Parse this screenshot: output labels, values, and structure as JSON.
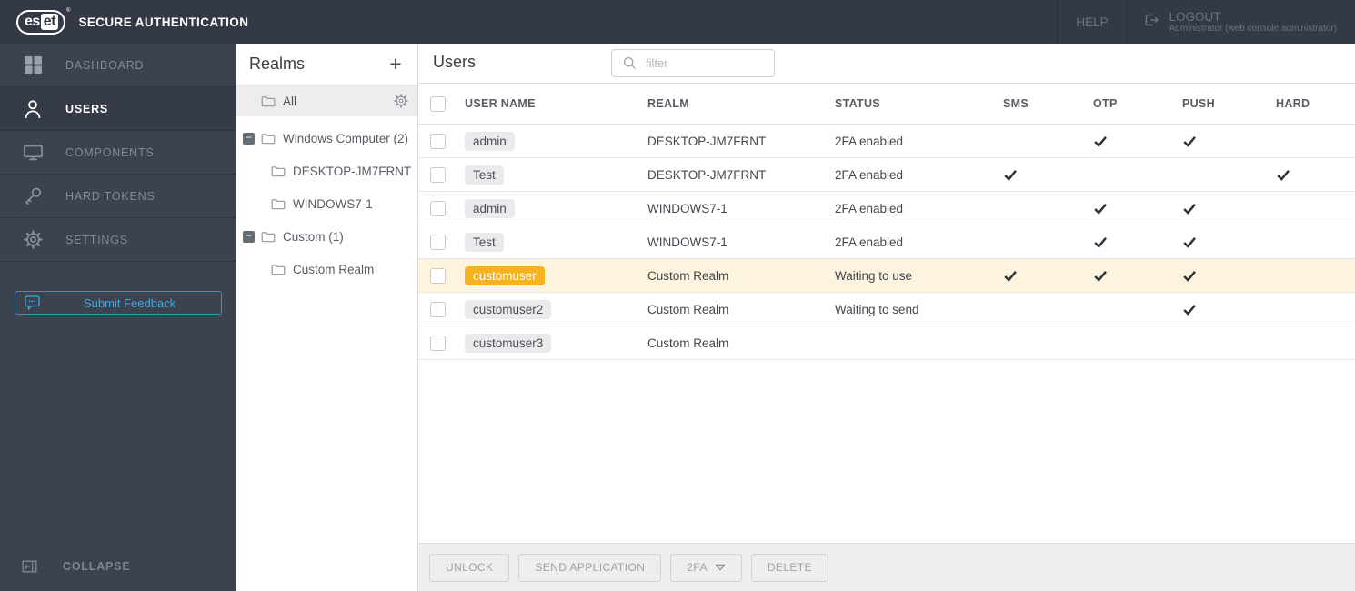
{
  "topbar": {
    "logo": {
      "left": "es",
      "right": "et",
      "reg": "®"
    },
    "product": "SECURE AUTHENTICATION",
    "help_label": "HELP",
    "logout_label": "LOGOUT",
    "logout_sub": "Administrator (web console administrator)"
  },
  "sidebar": {
    "items": [
      {
        "id": "dashboard",
        "label": "DASHBOARD",
        "icon": "grid",
        "active": false
      },
      {
        "id": "users",
        "label": "USERS",
        "icon": "user",
        "active": true
      },
      {
        "id": "components",
        "label": "COMPONENTS",
        "icon": "monitor",
        "active": false
      },
      {
        "id": "hard-tokens",
        "label": "HARD TOKENS",
        "icon": "key",
        "active": false
      },
      {
        "id": "settings",
        "label": "SETTINGS",
        "icon": "gear",
        "active": false
      }
    ],
    "feedback_label": "Submit Feedback",
    "collapse_label": "COLLAPSE"
  },
  "realms": {
    "title": "Realms",
    "all_label": "All",
    "tree": [
      {
        "id": "windows-computer",
        "label": "Windows Computer (2)",
        "level": 0,
        "expander": true
      },
      {
        "id": "desktop-jm7frnt",
        "label": "DESKTOP-JM7FRNT",
        "level": 1,
        "expander": false
      },
      {
        "id": "windows7-1",
        "label": "WINDOWS7-1",
        "level": 1,
        "expander": false
      },
      {
        "id": "custom",
        "label": "Custom (1)",
        "level": 0,
        "expander": true
      },
      {
        "id": "custom-realm",
        "label": "Custom Realm",
        "level": 1,
        "expander": false
      }
    ]
  },
  "users": {
    "title": "Users",
    "filter_placeholder": "filter",
    "columns": [
      "USER NAME",
      "REALM",
      "STATUS",
      "SMS",
      "OTP",
      "PUSH",
      "HARD"
    ],
    "rows": [
      {
        "user": "admin",
        "realm": "DESKTOP-JM7FRNT",
        "status": "2FA enabled",
        "sms": false,
        "otp": true,
        "push": true,
        "hard": false,
        "highlight": false
      },
      {
        "user": "Test",
        "realm": "DESKTOP-JM7FRNT",
        "status": "2FA enabled",
        "sms": true,
        "otp": false,
        "push": false,
        "hard": true,
        "highlight": false
      },
      {
        "user": "admin",
        "realm": "WINDOWS7-1",
        "status": "2FA enabled",
        "sms": false,
        "otp": true,
        "push": true,
        "hard": false,
        "highlight": false
      },
      {
        "user": "Test",
        "realm": "WINDOWS7-1",
        "status": "2FA enabled",
        "sms": false,
        "otp": true,
        "push": true,
        "hard": false,
        "highlight": false
      },
      {
        "user": "customuser",
        "realm": "Custom Realm",
        "status": "Waiting to use",
        "sms": true,
        "otp": true,
        "push": true,
        "hard": false,
        "highlight": true
      },
      {
        "user": "customuser2",
        "realm": "Custom Realm",
        "status": "Waiting to send",
        "sms": false,
        "otp": false,
        "push": true,
        "hard": false,
        "highlight": false
      },
      {
        "user": "customuser3",
        "realm": "Custom Realm",
        "status": "",
        "sms": false,
        "otp": false,
        "push": false,
        "hard": false,
        "highlight": false
      }
    ],
    "toolbar": [
      {
        "id": "unlock",
        "label": "UNLOCK",
        "dropdown": false
      },
      {
        "id": "send-application",
        "label": "SEND APPLICATION",
        "dropdown": false
      },
      {
        "id": "2fa",
        "label": "2FA",
        "dropdown": true
      },
      {
        "id": "delete",
        "label": "DELETE",
        "dropdown": false
      }
    ]
  },
  "colors": {
    "topbar_bg": "#333945",
    "sidebar_bg": "#3c424e",
    "accent_yellow": "#f5b31d",
    "highlight_row_bg": "#fcf4df",
    "feedback_blue": "#3fa9e0"
  }
}
